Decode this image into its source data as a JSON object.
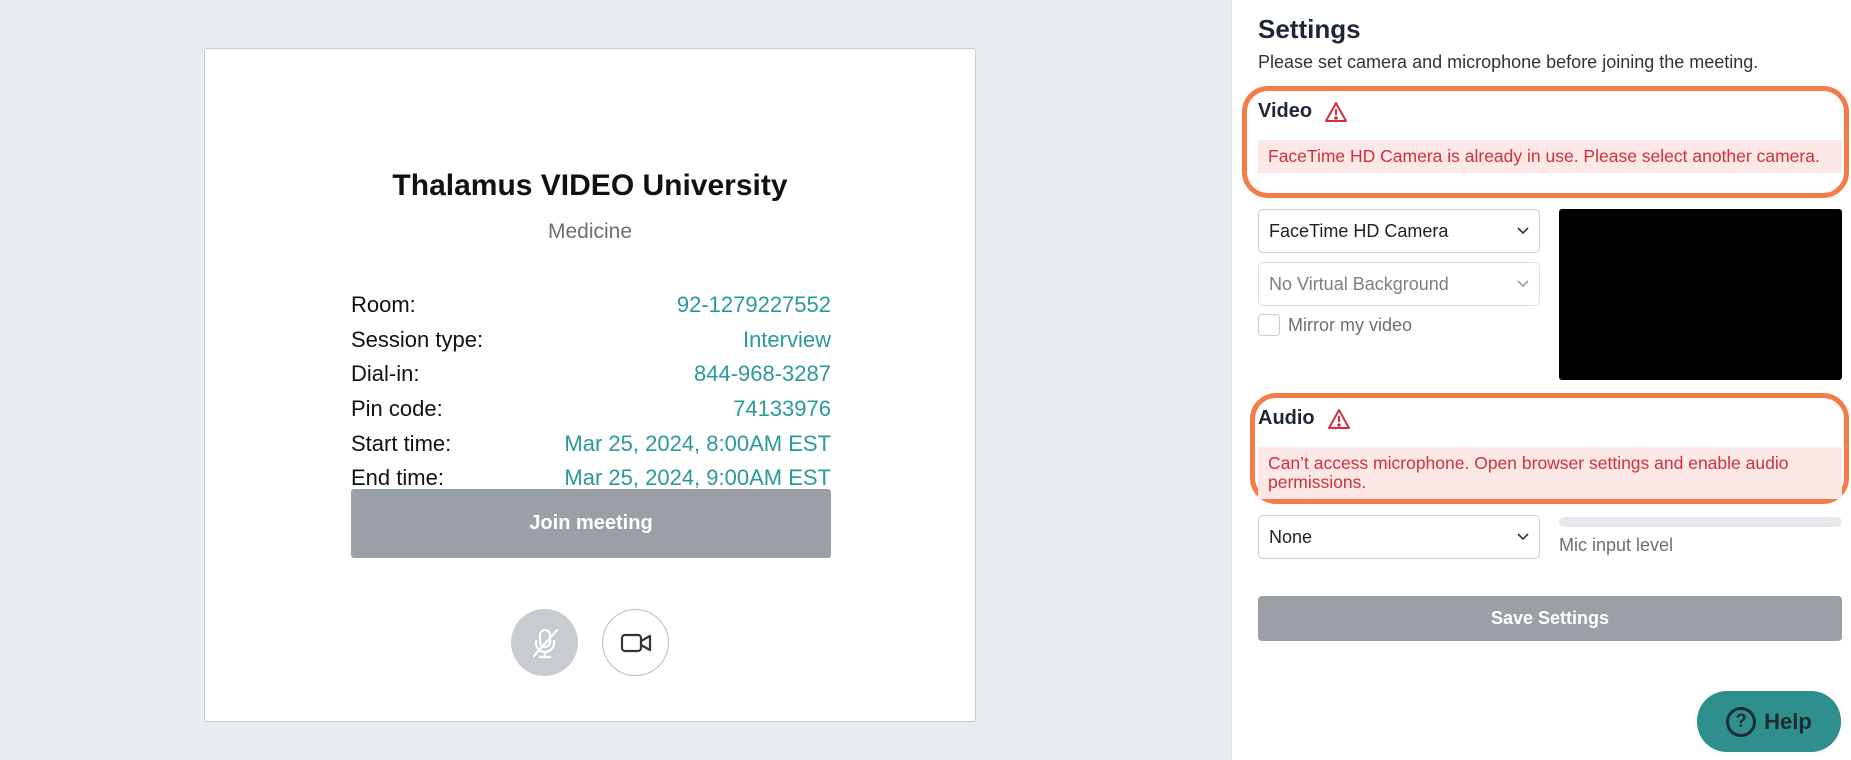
{
  "meeting": {
    "title": "Thalamus VIDEO University",
    "subtitle": "Medicine",
    "details": [
      {
        "label": "Room:",
        "value": "92-1279227552"
      },
      {
        "label": "Session type:",
        "value": "Interview"
      },
      {
        "label": "Dial-in:",
        "value": "844-968-3287"
      },
      {
        "label": "Pin code:",
        "value": "74133976"
      },
      {
        "label": "Start time:",
        "value": "Mar 25, 2024, 8:00AM EST"
      },
      {
        "label": "End time:",
        "value": "Mar 25, 2024, 9:00AM EST"
      }
    ],
    "join_label": "Join meeting",
    "mic_icon": "mic-muted-icon",
    "camera_icon": "video-camera-icon"
  },
  "settings": {
    "title": "Settings",
    "description": "Please set camera and microphone before joining the meeting.",
    "video": {
      "title": "Video",
      "error": "FaceTime HD Camera is already in use. Please select another camera.",
      "camera_select": "FaceTime HD Camera",
      "background_select": "No Virtual Background",
      "mirror_label": "Mirror my video",
      "mirror_checked": false
    },
    "audio": {
      "title": "Audio",
      "error": "Can’t access microphone. Open browser settings and enable audio permissions.",
      "mic_select": "None",
      "mic_level_label": "Mic input level",
      "mic_level": 0
    },
    "save_label": "Save Settings"
  },
  "help": {
    "label": "Help",
    "icon": "question-icon"
  },
  "colors": {
    "accent": "#2a9a98",
    "error": "#d2303c",
    "error_bg": "#fde8e8",
    "highlight": "#f47c4a",
    "disabled_button": "#9aa0a6",
    "help_button": "#2e8f8c"
  }
}
